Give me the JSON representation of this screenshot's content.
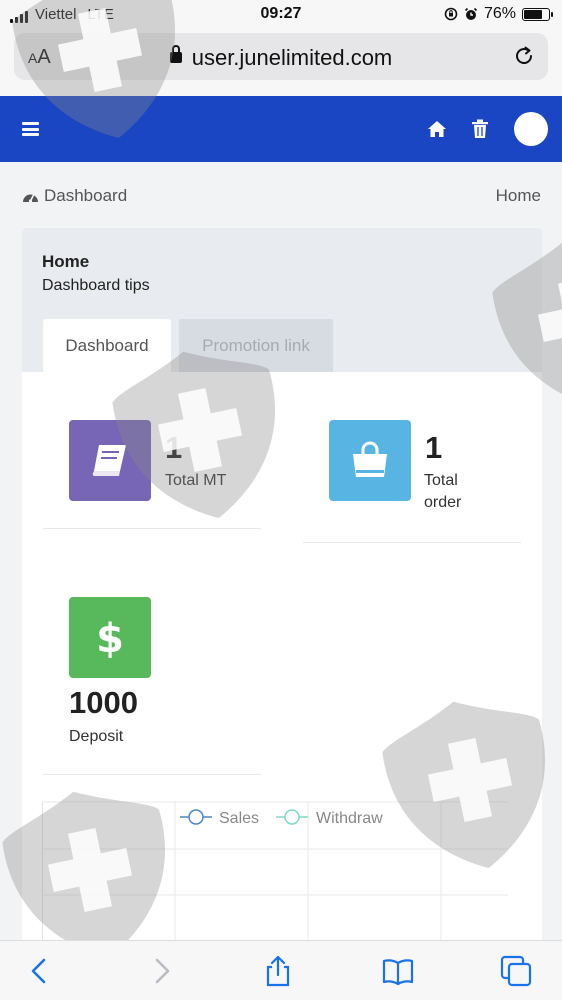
{
  "status_bar": {
    "carrier": "Viettel",
    "network": "LTE",
    "time": "09:27",
    "battery_text": "76%",
    "battery_level": 0.76
  },
  "browser": {
    "text_size_small": "A",
    "text_size_large": "A",
    "url": "user.junelimited.com"
  },
  "breadcrumb": {
    "section": "Dashboard",
    "current": "Home"
  },
  "card": {
    "title": "Home",
    "subtitle": "Dashboard tips",
    "tabs": [
      {
        "label": "Dashboard",
        "active": true
      },
      {
        "label": "Promotion link",
        "active": false
      }
    ]
  },
  "stats": [
    {
      "value": "1",
      "label": "Total MT",
      "icon": "book-icon",
      "color": "#7766b6"
    },
    {
      "value": "1",
      "label_line1": "Total",
      "label_line2": "order",
      "icon": "shopping-bag-icon",
      "color": "#58b5e3"
    },
    {
      "value": "1000",
      "label": "Deposit",
      "icon": "dollar-icon",
      "color": "#58b85c"
    }
  ],
  "chart_data": {
    "type": "line",
    "legend": [
      {
        "name": "Sales",
        "color": "#4b86c4"
      },
      {
        "name": "Withdraw",
        "color": "#7fd9c6"
      }
    ],
    "legend_position": "top",
    "grid": true
  },
  "colors": {
    "header": "#1b46c3",
    "page_bg": "#f2f3f5"
  }
}
